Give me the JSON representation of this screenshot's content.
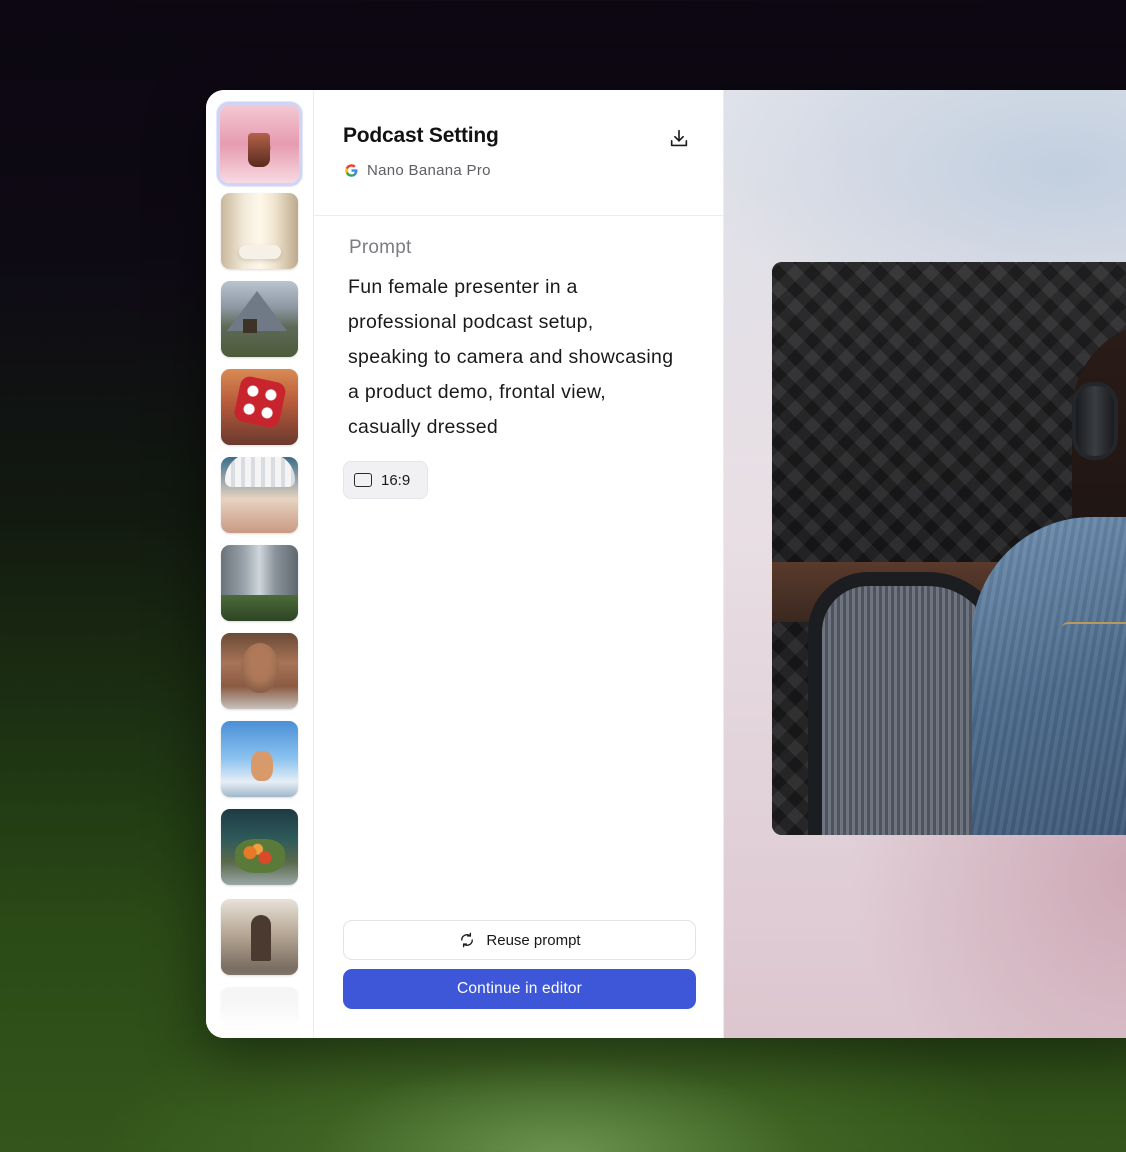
{
  "rail": {
    "thumbnails": [
      {
        "name": "thumbnail-pink-coffee",
        "selected": true
      },
      {
        "name": "thumbnail-white-interior",
        "selected": false
      },
      {
        "name": "thumbnail-mountain-cabin",
        "selected": false
      },
      {
        "name": "thumbnail-red-dice",
        "selected": false
      },
      {
        "name": "thumbnail-knit-hat-portrait",
        "selected": false
      },
      {
        "name": "thumbnail-city-street",
        "selected": false
      },
      {
        "name": "thumbnail-woman-portrait",
        "selected": false
      },
      {
        "name": "thumbnail-sky-character",
        "selected": false
      },
      {
        "name": "thumbnail-fish-terrarium",
        "selected": false
      },
      {
        "name": "thumbnail-airport-man",
        "selected": false
      },
      {
        "name": "thumbnail-faded",
        "selected": false
      }
    ]
  },
  "panel": {
    "title": "Podcast Setting",
    "model": {
      "icon": "google-icon",
      "name": "Nano Banana Pro"
    },
    "download_icon": "download-icon",
    "prompt_label": "Prompt",
    "prompt_text": "Fun female presenter in a professional podcast setup, speaking to camera and showcasing a product demo, frontal view, casually dressed",
    "aspect": {
      "icon": "aspect-ratio-icon",
      "label": "16:9"
    },
    "reuse_button": {
      "icon": "refresh-icon",
      "label": "Reuse prompt"
    },
    "continue_button": {
      "label": "Continue in editor"
    }
  },
  "colors": {
    "accent": "#3d57d8",
    "selected_border": "#cfd3f5"
  }
}
